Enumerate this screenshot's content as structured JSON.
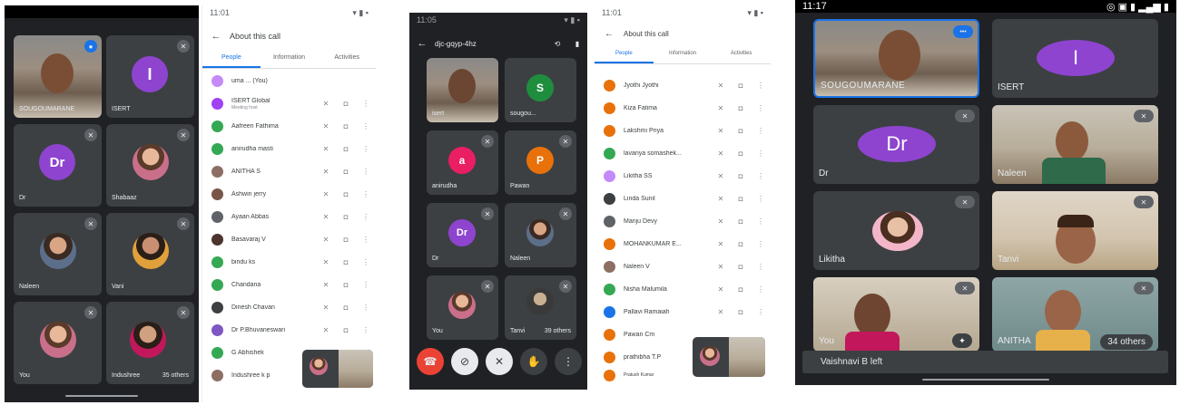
{
  "panel1": {
    "tiles": [
      {
        "name": "SOUGOUMARANE"
      },
      {
        "name": "ISERT",
        "initial": "I"
      },
      {
        "name": "Dr",
        "initial": "Dr"
      },
      {
        "name": "Shabaaz"
      },
      {
        "name": "Naleen"
      },
      {
        "name": "Vani"
      },
      {
        "name": "You"
      },
      {
        "name": "Indushree"
      }
    ],
    "others": "35 others"
  },
  "panel2": {
    "time": "11:01",
    "title": "About this call",
    "tabs": [
      "People",
      "Information",
      "Activities"
    ],
    "people": [
      {
        "name": "uma ... (You)",
        "color": "#c58af9"
      },
      {
        "name": "ISERT Global",
        "sub": "Meeting host",
        "color": "#a142f4"
      },
      {
        "name": "Aafreen Fathima",
        "color": "#34a853"
      },
      {
        "name": "anirudha masti",
        "color": "#34a853"
      },
      {
        "name": "ANITHA S",
        "color": "#8d6e63"
      },
      {
        "name": "Ashwin jerry",
        "color": "#795548"
      },
      {
        "name": "Ayaan Abbas",
        "color": "#5f6368"
      },
      {
        "name": "Basavaraj V",
        "color": "#4e342e"
      },
      {
        "name": "bindu ks",
        "color": "#34a853"
      },
      {
        "name": "Chandana",
        "color": "#34a853"
      },
      {
        "name": "Dinesh Chavan",
        "color": "#3c4043"
      },
      {
        "name": "Dr P.Bhuvaneswari",
        "color": "#7e57c2"
      },
      {
        "name": "G Abhishek",
        "color": "#34a853"
      },
      {
        "name": "Indushree k p",
        "color": "#8d6e63"
      }
    ]
  },
  "panel3": {
    "time": "11:05",
    "meeting_code": "djc-gqyp-4hz",
    "tiles": [
      {
        "name": "isert"
      },
      {
        "name": "sougou...",
        "initial": "S"
      },
      {
        "name": "anirudha",
        "initial": "a"
      },
      {
        "name": "Pawan",
        "initial": "P"
      },
      {
        "name": "Dr",
        "initial": "Dr"
      },
      {
        "name": "Naleen"
      },
      {
        "name": "You"
      },
      {
        "name": "Tanvi"
      }
    ],
    "others": "39 others"
  },
  "panel4": {
    "time": "11:01",
    "title": "About this call",
    "tabs": [
      "People",
      "Information",
      "Activities"
    ],
    "people": [
      {
        "name": "Jyothi Jyothi",
        "color": "#e8710a"
      },
      {
        "name": "Kiza Fatima",
        "color": "#e8710a"
      },
      {
        "name": "Lakshmi Priya",
        "color": "#e8710a"
      },
      {
        "name": "lavanya somashek...",
        "color": "#34a853"
      },
      {
        "name": "Likitha SS",
        "color": "#c58af9"
      },
      {
        "name": "Linda Sunil",
        "color": "#3c4043"
      },
      {
        "name": "Manju Devy",
        "color": "#5f6368"
      },
      {
        "name": "MOHANKUMAR E...",
        "color": "#e8710a"
      },
      {
        "name": "Naleen V",
        "color": "#8d6e63"
      },
      {
        "name": "Nisha Malumila",
        "color": "#34a853"
      },
      {
        "name": "Pallavi Ramaiah",
        "color": "#1a73e8"
      },
      {
        "name": "Pawan Cm",
        "color": "#e8710a"
      },
      {
        "name": "prathibha T.P",
        "color": "#e8710a"
      },
      {
        "name": "Pratush Kumar",
        "color": "#e8710a"
      }
    ]
  },
  "panel5": {
    "time": "11:17",
    "tiles": [
      {
        "name": "SOUGOUMARANE"
      },
      {
        "name": "ISERT",
        "initial": "I"
      },
      {
        "name": "Dr",
        "initial": "Dr"
      },
      {
        "name": "Naleen"
      },
      {
        "name": "Likitha"
      },
      {
        "name": "Tanvi"
      },
      {
        "name": "You"
      },
      {
        "name": "ANITHA"
      }
    ],
    "others": "34 others",
    "toast": "Vaishnavi B left"
  },
  "colors": {
    "purple": "#8e44cf",
    "blue": "#1a73e8",
    "orange": "#e8710a",
    "green": "#1e8e3e",
    "pink": "#e91e63",
    "red": "#ea4335"
  }
}
